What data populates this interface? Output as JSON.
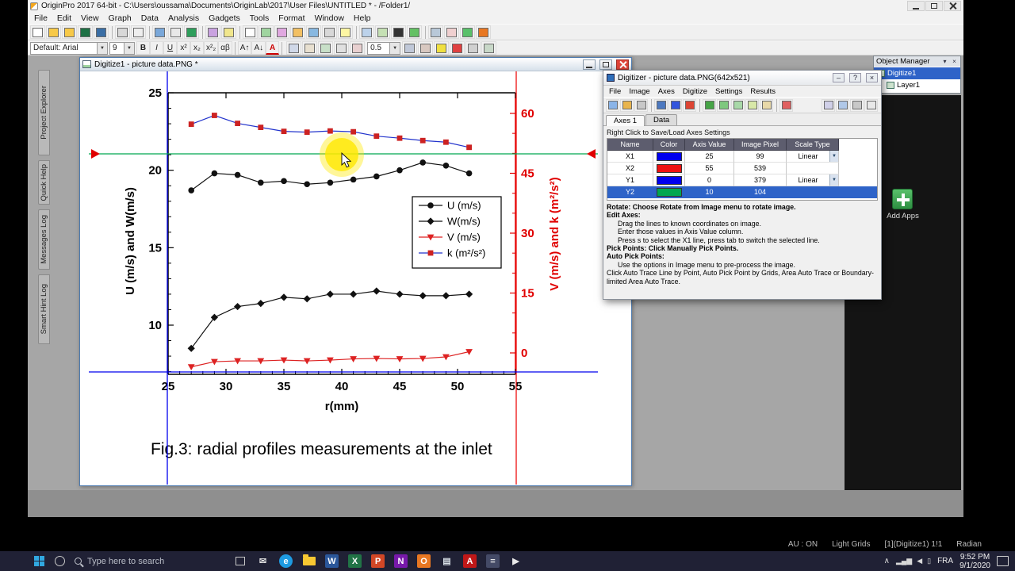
{
  "icons": {
    "dropdown": "▼",
    "help": "?",
    "close": "×",
    "minimize": "–",
    "pin": "▾",
    "caret_up": "∧"
  },
  "app": {
    "title": "OriginPro 2017 64-bit - C:\\Users\\oussama\\Documents\\OriginLab\\2017\\User Files\\UNTITLED * - /Folder1/",
    "menus": [
      "File",
      "Edit",
      "View",
      "Graph",
      "Data",
      "Analysis",
      "Gadgets",
      "Tools",
      "Format",
      "Window",
      "Help"
    ],
    "toolbar_main_icons": [
      {
        "name": "new-project",
        "c": "#ffffff"
      },
      {
        "name": "new-folder",
        "c": "#f7c948"
      },
      {
        "name": "open",
        "c": "#f7c948"
      },
      {
        "name": "open-excel",
        "c": "#1e7145"
      },
      {
        "name": "save-project",
        "c": "#3a6ea5"
      },
      {
        "sep": true
      },
      {
        "name": "print",
        "c": "#d8d8d8"
      },
      {
        "name": "print-preview",
        "c": "#eeeeee"
      },
      {
        "sep": true
      },
      {
        "name": "import-wizard",
        "c": "#79a7d9"
      },
      {
        "name": "import-single-ascii",
        "c": "#e8e8e8"
      },
      {
        "name": "import-excel",
        "c": "#2e9e5b"
      },
      {
        "sep": true
      },
      {
        "name": "digitize-image",
        "c": "#c9a2e0"
      },
      {
        "name": "screen-reader",
        "c": "#f0e68c"
      },
      {
        "sep": true
      },
      {
        "name": "new-workbook",
        "c": "#ffffff"
      },
      {
        "name": "new-graph",
        "c": "#9fd49f"
      },
      {
        "name": "new-matrix",
        "c": "#e0a8e0"
      },
      {
        "name": "new-function-plot",
        "c": "#f2c063"
      },
      {
        "name": "new-3d-plot",
        "c": "#88b8e0"
      },
      {
        "name": "new-layout",
        "c": "#d8d8d8"
      },
      {
        "name": "new-notes",
        "c": "#fdf6a3"
      },
      {
        "sep": true
      },
      {
        "name": "project-explorer",
        "c": "#bcd2ea"
      },
      {
        "name": "results-log",
        "c": "#c5e0b4"
      },
      {
        "name": "command-window",
        "c": "#333333"
      },
      {
        "name": "refresh",
        "c": "#63c063"
      },
      {
        "sep": true
      },
      {
        "name": "duplicate-window",
        "c": "#b8c8d8"
      },
      {
        "name": "snapshot",
        "c": "#f0d0d0"
      },
      {
        "name": "add-apps-toolbar",
        "c": "#59c06a"
      },
      {
        "name": "apps-gallery",
        "c": "#e87722"
      }
    ],
    "toolbar_format": {
      "font_preset": "Default: Arial",
      "font_size": "9",
      "line_width": "0.5",
      "buttons": [
        {
          "name": "bold",
          "g": "B",
          "cls": "gb"
        },
        {
          "name": "italic",
          "g": "I",
          "cls": "gi"
        },
        {
          "name": "underline",
          "g": "U",
          "cls": "gu"
        },
        {
          "name": "superscript",
          "g": "x²"
        },
        {
          "name": "subscript",
          "g": "x₂"
        },
        {
          "name": "super-and-subscript",
          "g": "x²₂"
        },
        {
          "name": "greek",
          "g": "αβ"
        },
        {
          "sep": true
        },
        {
          "name": "increase-font",
          "g": "A↑"
        },
        {
          "name": "decrease-font",
          "g": "A↓"
        },
        {
          "name": "font-color",
          "g": "A",
          "cls": "gcolor"
        },
        {
          "sep": true
        }
      ],
      "icons2": [
        {
          "name": "symbol-map",
          "c": "#d0d8e8"
        },
        {
          "name": "insert-equation",
          "c": "#e8e0d0"
        },
        {
          "name": "insert-graph",
          "c": "#c8e0c8"
        },
        {
          "name": "insert-table",
          "c": "#e0e0e0"
        },
        {
          "name": "insert-image",
          "c": "#e8d0d0"
        }
      ],
      "icons3": [
        {
          "name": "line-style",
          "c": "#c0c8d8"
        },
        {
          "name": "arrow-style",
          "c": "#d8c8c0"
        },
        {
          "name": "fill-color",
          "c": "#f0e040"
        },
        {
          "name": "line-color",
          "c": "#e04040"
        },
        {
          "name": "pattern",
          "c": "#d0d0d0"
        },
        {
          "name": "group",
          "c": "#c8d8c8"
        }
      ]
    },
    "sidebar_tabs": [
      "Project Explorer",
      "Quick Help",
      "Messages Log",
      "Smart Hint Log"
    ],
    "status": [
      "AU : ON",
      "Light Grids",
      "[1](Digitize1) 1!1",
      "Radian"
    ]
  },
  "graph_window": {
    "title": "Digitize1 - picture data.PNG *"
  },
  "digitizer": {
    "title": "Digitizer - picture data.PNG(642x521)",
    "menus": [
      "File",
      "Image",
      "Axes",
      "Digitize",
      "Settings",
      "Results"
    ],
    "tabs": [
      "Axes 1",
      "Data"
    ],
    "active_tab": "Axes 1",
    "hint": "Right Click to Save/Load Axes Settings",
    "toolbar_icons": [
      {
        "name": "import-image",
        "c": "#8ab4e8"
      },
      {
        "name": "rotate-image",
        "c": "#e8b44d"
      },
      {
        "name": "crop-image",
        "c": "#c8c8c8"
      },
      {
        "sep": true
      },
      {
        "name": "edit-axes",
        "c": "#4d79c0"
      },
      {
        "name": "add-x-axis-lines",
        "c": "#3355dd"
      },
      {
        "name": "add-y-axis-lines",
        "c": "#dd4433"
      },
      {
        "sep": true
      },
      {
        "name": "manual-pick-points",
        "c": "#47a447"
      },
      {
        "name": "auto-trace-line-by-point",
        "c": "#7ec87e"
      },
      {
        "name": "auto-pick-by-grids",
        "c": "#a8d8a8"
      },
      {
        "name": "area-auto-trace",
        "c": "#d8e8a8"
      },
      {
        "name": "boundary-area-auto-trace",
        "c": "#e8d8a8"
      },
      {
        "sep": true
      },
      {
        "name": "delete-points",
        "c": "#e06060"
      }
    ],
    "toolbar_icons_right": [
      {
        "name": "goto-data",
        "c": "#d0d0e8"
      },
      {
        "name": "goto-graph",
        "c": "#b0c8e8"
      },
      {
        "name": "reorder-curve",
        "c": "#c8c8c8"
      },
      {
        "name": "close-digitizer-tool",
        "c": "#e8e8e8"
      }
    ],
    "table": {
      "headers": [
        "Name",
        "Color",
        "Axis Value",
        "Image Pixel",
        "Scale Type"
      ],
      "rows": [
        {
          "name": "X1",
          "color": "#0000ee",
          "axis_value": "25",
          "image_pixel": "99",
          "scale_type": "Linear",
          "selected": false
        },
        {
          "name": "X2",
          "color": "#ee1111",
          "axis_value": "55",
          "image_pixel": "539",
          "scale_type": "",
          "selected": false
        },
        {
          "name": "Y1",
          "color": "#0000ee",
          "axis_value": "0",
          "image_pixel": "379",
          "scale_type": "Linear",
          "selected": false
        },
        {
          "name": "Y2",
          "color": "#00a651",
          "axis_value": "10",
          "image_pixel": "104",
          "scale_type": "",
          "selected": true
        }
      ]
    },
    "help": [
      {
        "t": "Rotate: Choose Rotate from Image menu to rotate image.",
        "i": 0,
        "b": true
      },
      {
        "t": "Edit Axes:",
        "i": 0,
        "b": true
      },
      {
        "t": "Drag the lines to known coordinates on image.",
        "i": 1,
        "b": false
      },
      {
        "t": "Enter those values in Axis Value column.",
        "i": 1,
        "b": false
      },
      {
        "t": "Press s to select the X1 line, press tab to switch the selected line.",
        "i": 1,
        "b": false
      },
      {
        "t": "Pick Points: Click Manually Pick Points.",
        "i": 0,
        "b": true
      },
      {
        "t": "Auto Pick Points:",
        "i": 0,
        "b": true
      },
      {
        "t": "Use the options in Image menu to pre-process the image.",
        "i": 1,
        "b": false
      },
      {
        "t": "Click Auto Trace Line by Point, Auto Pick Point by Grids, Area Auto Trace or Boundary-limited Area Auto Trace.",
        "i": 0,
        "b": false
      }
    ]
  },
  "object_manager": {
    "title": "Object Manager",
    "items": [
      {
        "label": "Digitize1",
        "selected": true
      },
      {
        "label": "Layer1",
        "selected": false
      }
    ]
  },
  "apps_panel": {
    "add_label": "Add Apps"
  },
  "taskbar": {
    "search_text": "Type here to search",
    "language": "FRA",
    "time": "9:52 PM",
    "date": "9/1/2020",
    "app_icons": [
      {
        "name": "mail",
        "g": "✉",
        "fg": "#e0e0e0"
      },
      {
        "name": "edge-browser",
        "g": "e",
        "fg": "#ffffff",
        "bg": "#1e9be2",
        "round": true
      },
      {
        "name": "file-explorer",
        "folder": true
      },
      {
        "name": "word",
        "g": "W",
        "fg": "#ffffff",
        "bg": "#2b579a"
      },
      {
        "name": "excel",
        "g": "X",
        "fg": "#ffffff",
        "bg": "#217346"
      },
      {
        "name": "powerpoint",
        "g": "P",
        "fg": "#ffffff",
        "bg": "#d24726"
      },
      {
        "name": "onenote",
        "g": "N",
        "fg": "#ffffff",
        "bg": "#7719aa"
      },
      {
        "name": "origin",
        "g": "O",
        "fg": "#ffffff",
        "bg": "#e87722"
      },
      {
        "name": "notepad",
        "g": "▤",
        "fg": "#d8e0e8"
      },
      {
        "name": "acrobat",
        "g": "A",
        "fg": "#ffffff",
        "bg": "#c01818"
      },
      {
        "name": "calculator",
        "g": "=",
        "fg": "#e8e8e8",
        "bg": "#444a66"
      },
      {
        "name": "media-player",
        "g": "▶",
        "fg": "#e8e8e8"
      }
    ],
    "tray_icons": [
      {
        "name": "network",
        "g": "▂▄▆"
      },
      {
        "name": "speaker",
        "g": "◀"
      },
      {
        "name": "battery",
        "g": "▯"
      }
    ]
  },
  "chart_data": {
    "type": "line",
    "title": "Fig.3: radial profiles measurements at the inlet",
    "xlabel": "r(mm)",
    "ylabel_left": "U (m/s) and W(m/s)",
    "ylabel_right": "V (m/s) and  k (m²/s²)",
    "x_range": [
      25,
      55
    ],
    "left_range": [
      6.8,
      25
    ],
    "right_range": [
      -5.4,
      65.2
    ],
    "x_ticks": [
      25,
      30,
      35,
      40,
      45,
      50,
      55
    ],
    "left_ticks": [
      25,
      20,
      15,
      10
    ],
    "right_ticks": [
      60,
      45,
      30,
      15,
      0
    ],
    "grid": false,
    "legend_position": "right-middle",
    "x": [
      27,
      29,
      31,
      33,
      35,
      37,
      39,
      41,
      43,
      45,
      47,
      49,
      51
    ],
    "series": [
      {
        "name": "U",
        "label": "U (m/s)",
        "axis": "left",
        "marker": "circle",
        "line_color": "#111111",
        "marker_color": "#111111",
        "values": [
          18.7,
          19.8,
          19.7,
          19.2,
          19.3,
          19.1,
          19.2,
          19.4,
          19.6,
          20.0,
          20.5,
          20.3,
          19.8
        ]
      },
      {
        "name": "W",
        "label": "W(m/s)",
        "axis": "left",
        "marker": "diamond",
        "line_color": "#111111",
        "marker_color": "#111111",
        "values": [
          8.5,
          10.5,
          11.2,
          11.4,
          11.8,
          11.7,
          12.0,
          12.0,
          12.2,
          12.0,
          11.9,
          11.9,
          12.0
        ]
      },
      {
        "name": "V",
        "label": "V (m/s)",
        "axis": "right",
        "marker": "triangle-down",
        "line_color": "#dd2222",
        "marker_color": "#dd2222",
        "values": [
          -3.5,
          -2.2,
          -2.0,
          -2.0,
          -1.8,
          -2.0,
          -1.8,
          -1.5,
          -1.4,
          -1.5,
          -1.4,
          -1.0,
          0.3
        ]
      },
      {
        "name": "k",
        "label": "k (m²/s²)",
        "axis": "right",
        "marker": "square",
        "line_color": "#2233cc",
        "marker_color": "#cc2222",
        "values": [
          57.3,
          59.5,
          57.5,
          56.5,
          55.5,
          55.3,
          55.6,
          55.4,
          54.3,
          53.8,
          53.2,
          52.8,
          51.5
        ]
      }
    ],
    "cursor_highlight": {
      "x": 319,
      "y": 105
    }
  }
}
